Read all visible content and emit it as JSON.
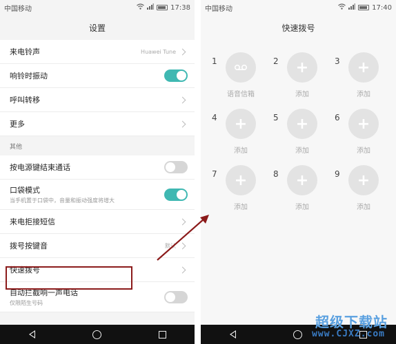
{
  "left": {
    "status": {
      "carrier": "中国移动",
      "time": "17:38"
    },
    "title": "设置",
    "rows1": [
      {
        "label": "来电铃声",
        "value": "Huawei Tune",
        "control": "chevron"
      },
      {
        "label": "响铃时振动",
        "control": "toggle-on"
      },
      {
        "label": "呼叫转移",
        "control": "chevron"
      },
      {
        "label": "更多",
        "control": "chevron"
      }
    ],
    "section_title": "其他",
    "rows2": [
      {
        "label": "按电源键结束通话",
        "control": "toggle-off"
      },
      {
        "label": "口袋模式",
        "sub": "当手机置于口袋中，音量和振动强度将增大",
        "control": "toggle-on"
      },
      {
        "label": "来电拒接短信",
        "control": "chevron"
      },
      {
        "label": "拨号按键音",
        "value": "默认",
        "control": "chevron"
      },
      {
        "label": "快速拨号",
        "control": "chevron"
      },
      {
        "label": "自动拦截响一声电话",
        "sub": "仅限陌生号码",
        "control": "toggle-off"
      }
    ]
  },
  "right": {
    "status": {
      "carrier": "中国移动",
      "time": "17:40"
    },
    "title": "快速拨号",
    "slots": [
      {
        "number": "1",
        "label": "语音信箱",
        "icon": "voicemail-icon"
      },
      {
        "number": "2",
        "label": "添加",
        "icon": "plus-icon"
      },
      {
        "number": "3",
        "label": "添加",
        "icon": "plus-icon"
      },
      {
        "number": "4",
        "label": "添加",
        "icon": "plus-icon"
      },
      {
        "number": "5",
        "label": "添加",
        "icon": "plus-icon"
      },
      {
        "number": "6",
        "label": "添加",
        "icon": "plus-icon"
      },
      {
        "number": "7",
        "label": "添加",
        "icon": "plus-icon"
      },
      {
        "number": "8",
        "label": "添加",
        "icon": "plus-icon"
      },
      {
        "number": "9",
        "label": "添加",
        "icon": "plus-icon"
      }
    ]
  },
  "watermark": {
    "cn": "超级下载站",
    "en": "www.CJXZ.com"
  },
  "colors": {
    "toggle_on": "#3fb8b2",
    "highlight_box": "#8b1a1a",
    "arrow": "#8b1a1a"
  }
}
